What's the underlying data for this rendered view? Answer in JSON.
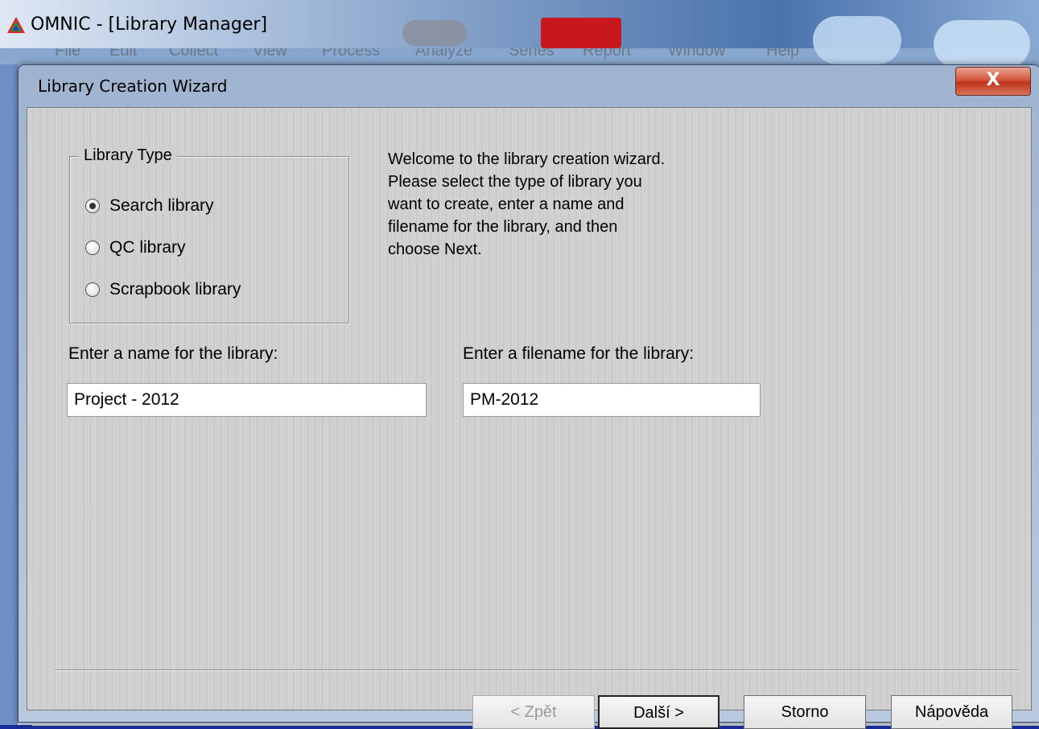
{
  "app": {
    "title": "OMNIC - [Library Manager]",
    "menu": [
      "File",
      "Edit",
      "Collect",
      "View",
      "Process",
      "Analyze",
      "Series",
      "Report",
      "Window",
      "Help"
    ]
  },
  "dialog": {
    "title": "Library Creation Wizard",
    "close_label": "X",
    "library_type": {
      "legend": "Library Type",
      "options": [
        {
          "label": "Search library",
          "selected": true
        },
        {
          "label": "QC library",
          "selected": false
        },
        {
          "label": "Scrapbook library",
          "selected": false
        }
      ]
    },
    "welcome_lines": [
      "Welcome to the library creation wizard.",
      "Please select the type of library you",
      "want to create, enter a name and",
      "filename for the library, and then",
      "choose Next."
    ],
    "name_field": {
      "label": "Enter a name for the library:",
      "value": "Project - 2012"
    },
    "filename_field": {
      "label": "Enter a filename for the library:",
      "value": "PM-2012"
    },
    "buttons": {
      "back": "< Zpět",
      "next": "Další >",
      "cancel": "Storno",
      "help": "Nápověda"
    }
  },
  "icons": {
    "app_logo": "omnic-logo-icon",
    "close": "close-icon"
  },
  "colors": {
    "close_button": "#c0331a",
    "dialog_client": "#d0d0d0"
  }
}
